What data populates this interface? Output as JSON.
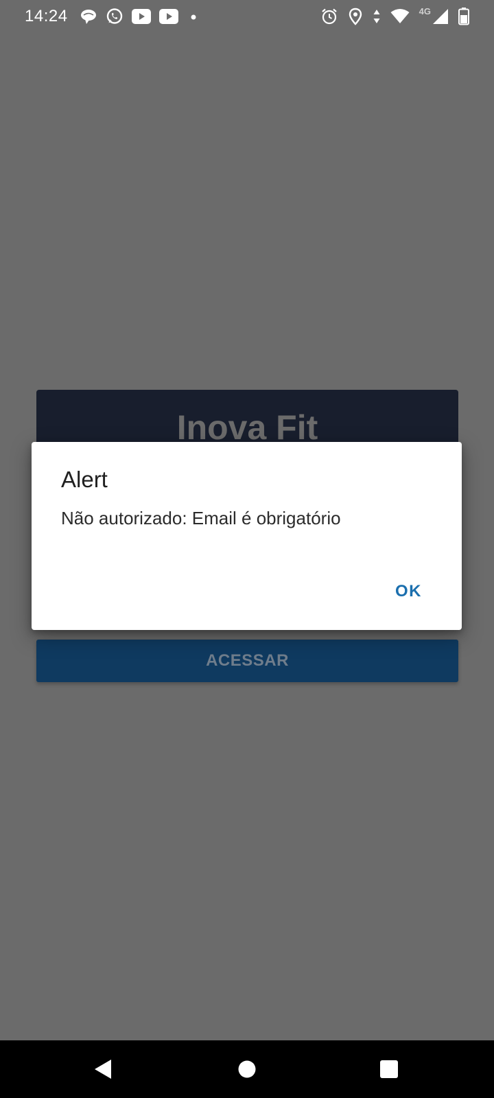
{
  "status_bar": {
    "time": "14:24",
    "network_label": "4G",
    "left_icons": [
      "chat-bubble-icon",
      "whatsapp-icon",
      "youtube-icon",
      "youtube-icon",
      "dot-icon"
    ],
    "right_icons": [
      "alarm-icon",
      "location-icon",
      "data-arrows-icon",
      "wifi-icon",
      "cell-signal-icon",
      "battery-icon"
    ]
  },
  "login": {
    "title": "Inova Fit",
    "access_button_label": "ACESSAR"
  },
  "dialog": {
    "title": "Alert",
    "message": "Não autorizado: Email é obrigatório",
    "ok_label": "OK"
  },
  "nav_bar": {
    "buttons": [
      "back-icon",
      "home-icon",
      "recents-icon"
    ]
  },
  "colors": {
    "scrim": "#6b6b6b",
    "card_header": "#181e2d",
    "access_button": "#0f3a60",
    "dialog_button_text": "#1b6fae",
    "dialog_background": "#ffffff",
    "nav_background": "#000000"
  }
}
